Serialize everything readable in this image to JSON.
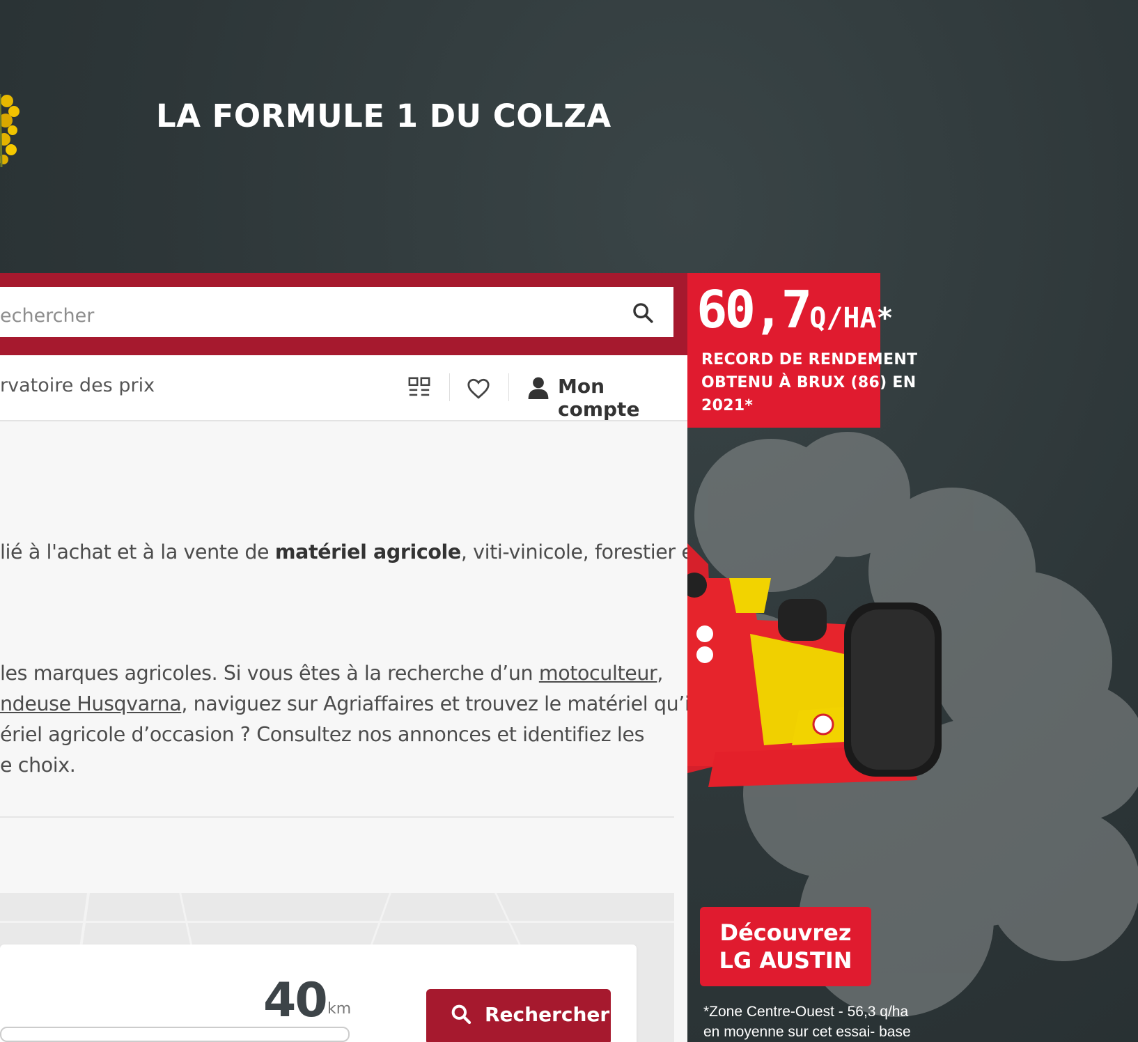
{
  "banner": {
    "title": "LA FORMULE 1 DU COLZA"
  },
  "search": {
    "placeholder": "echercher",
    "icon": "search-icon"
  },
  "nav": {
    "link": "rvatoire des prix",
    "icons": [
      "grid-icon",
      "heart-icon",
      "user-icon"
    ],
    "account_label": "Mon compte"
  },
  "intro": {
    "line1_a": "lié à l'achat et à la vente de ",
    "line1_bold": "matériel agricole",
    "line1_b": ", viti-vinicole, forestier et",
    "line2_a": "les marques agricoles. Si vous êtes à la recherche d’un ",
    "line2_link": "motoculteur",
    "line2_b": ",",
    "line3_link": "ndeuse Husqvarna",
    "line3_b": ", naviguez sur Agriaffaires et trouvez le matériel qu’il",
    "line4": "ériel agricole d’occasion ? Consultez nos annonces et identifiez les",
    "line5": "e choix."
  },
  "location": {
    "radius_value": "40",
    "radius_unit": "km",
    "search_button": "Rechercher"
  },
  "ad": {
    "big_number": "60,7",
    "big_unit": "Q/HA*",
    "line1": "RECORD DE RENDEMENT",
    "line2": "OBTENU À BRUX (86) EN",
    "line3": "2021*",
    "cta_line1": "Découvrez",
    "cta_line2": "LG AUSTIN",
    "footnote1": "*Zone Centre-Ouest - 56,3 q/ha",
    "footnote2": "en moyenne sur cet essai- base"
  },
  "colors": {
    "brand_red": "#a6192e",
    "ad_red": "#e01b2f",
    "banner_bg": "#2d3638"
  }
}
